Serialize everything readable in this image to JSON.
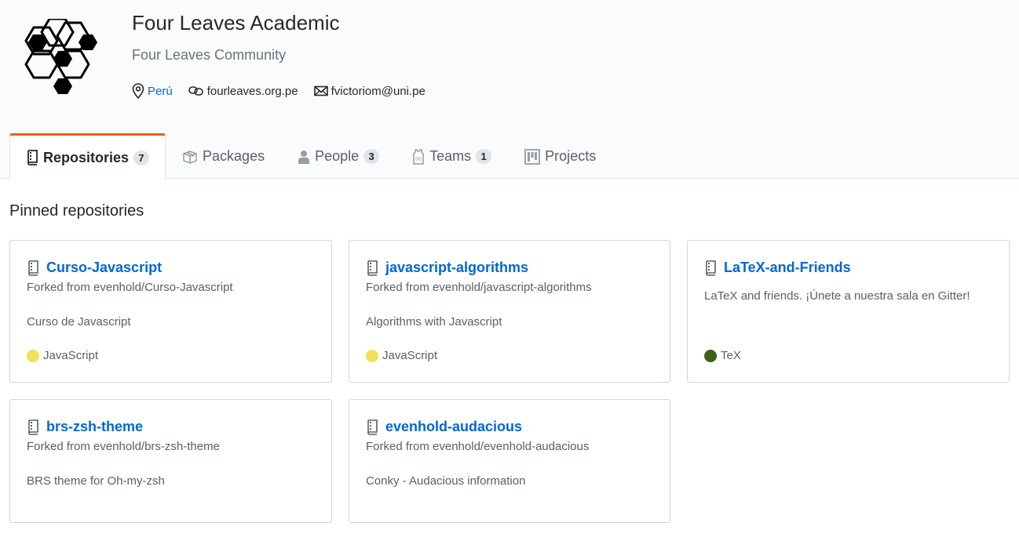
{
  "org": {
    "name": "Four Leaves Academic",
    "description": "Four Leaves Community",
    "location": "Perú",
    "website": "fourleaves.org.pe",
    "email": "fvictoriom@uni.pe"
  },
  "tabs": [
    {
      "label": "Repositories",
      "count": "7",
      "icon": "repo-icon",
      "selected": true
    },
    {
      "label": "Packages",
      "count": "",
      "icon": "package-icon",
      "selected": false
    },
    {
      "label": "People",
      "count": "3",
      "icon": "person-icon",
      "selected": false
    },
    {
      "label": "Teams",
      "count": "1",
      "icon": "jersey-icon",
      "selected": false
    },
    {
      "label": "Projects",
      "count": "",
      "icon": "project-icon",
      "selected": false
    }
  ],
  "pinned": {
    "heading": "Pinned repositories",
    "repos": [
      {
        "name": "Curso-Javascript",
        "fork": "Forked from evenhold/Curso-Javascript",
        "description": "Curso de Javascript",
        "language": "JavaScript",
        "language_color": "#f1e05a"
      },
      {
        "name": "javascript-algorithms",
        "fork": "Forked from evenhold/javascript-algorithms",
        "description": "Algorithms with Javascript",
        "language": "JavaScript",
        "language_color": "#f1e05a"
      },
      {
        "name": "LaTeX-and-Friends",
        "fork": "",
        "description": "LaTeX and friends. ¡Únete a nuestra sala en Gitter!",
        "language": "TeX",
        "language_color": "#3d6117"
      },
      {
        "name": "brs-zsh-theme",
        "fork": "Forked from evenhold/brs-zsh-theme",
        "description": "BRS theme for Oh-my-zsh",
        "language": "",
        "language_color": ""
      },
      {
        "name": "evenhold-audacious",
        "fork": "Forked from evenhold/evenhold-audacious",
        "description": "Conky - Audacious information",
        "language": "",
        "language_color": ""
      }
    ]
  },
  "colors": {
    "accent": "#e36209",
    "link": "#0366d6",
    "muted": "#586069"
  }
}
